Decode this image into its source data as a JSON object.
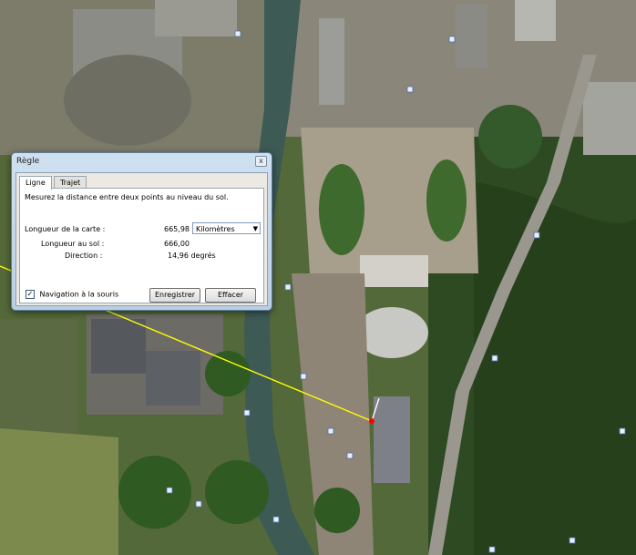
{
  "dialog": {
    "title": "Règle",
    "close_glyph": "x",
    "tabs": [
      {
        "label": "Ligne",
        "active": true
      },
      {
        "label": "Trajet",
        "active": false
      }
    ],
    "description": "Mesurez la distance entre deux points au niveau du sol.",
    "map_length_label": "Longueur de la carte :",
    "map_length_value": "665,98",
    "unit_selected": "Kilomètres",
    "ground_length_label": "Longueur au sol :",
    "ground_length_value": "666,00",
    "direction_label": "Direction :",
    "direction_value": "14,96 degrés",
    "mouse_nav_label": "Navigation à la souris",
    "mouse_nav_checked": true,
    "save_label": "Enregistrer",
    "clear_label": "Effacer"
  },
  "map": {
    "type": "aerial-satellite",
    "measure_line_color": "#ffff00",
    "endpoint_color": "#ff0000"
  }
}
